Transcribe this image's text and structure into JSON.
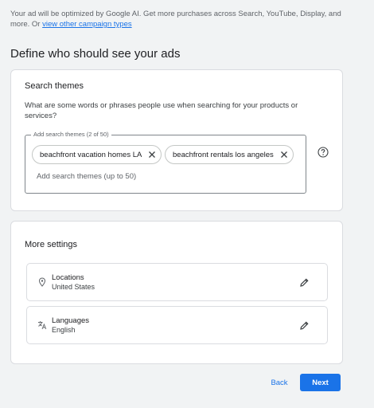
{
  "intro": {
    "text": "Your ad will be optimized by Google AI. Get more purchases across Search, YouTube, Display, and more. Or ",
    "link": "view other campaign types"
  },
  "section_title": "Define who should see your ads",
  "search_themes": {
    "title": "Search themes",
    "question": "What are some words or phrases people use when searching for your products or services?",
    "field_label": "Add search themes (2 of 50)",
    "chips": [
      {
        "label": "beachfront vacation homes LA"
      },
      {
        "label": "beachfront rentals los angeles"
      }
    ],
    "input_placeholder": "Add search themes (up to 50)"
  },
  "more_settings": {
    "title": "More settings",
    "items": [
      {
        "label": "Locations",
        "value": "United States",
        "icon": "location-pin-icon"
      },
      {
        "label": "Languages",
        "value": "English",
        "icon": "translate-icon"
      }
    ]
  },
  "buttons": {
    "back": "Back",
    "next": "Next"
  },
  "colors": {
    "accent": "#1a73e8",
    "background": "#f1f3f4"
  }
}
